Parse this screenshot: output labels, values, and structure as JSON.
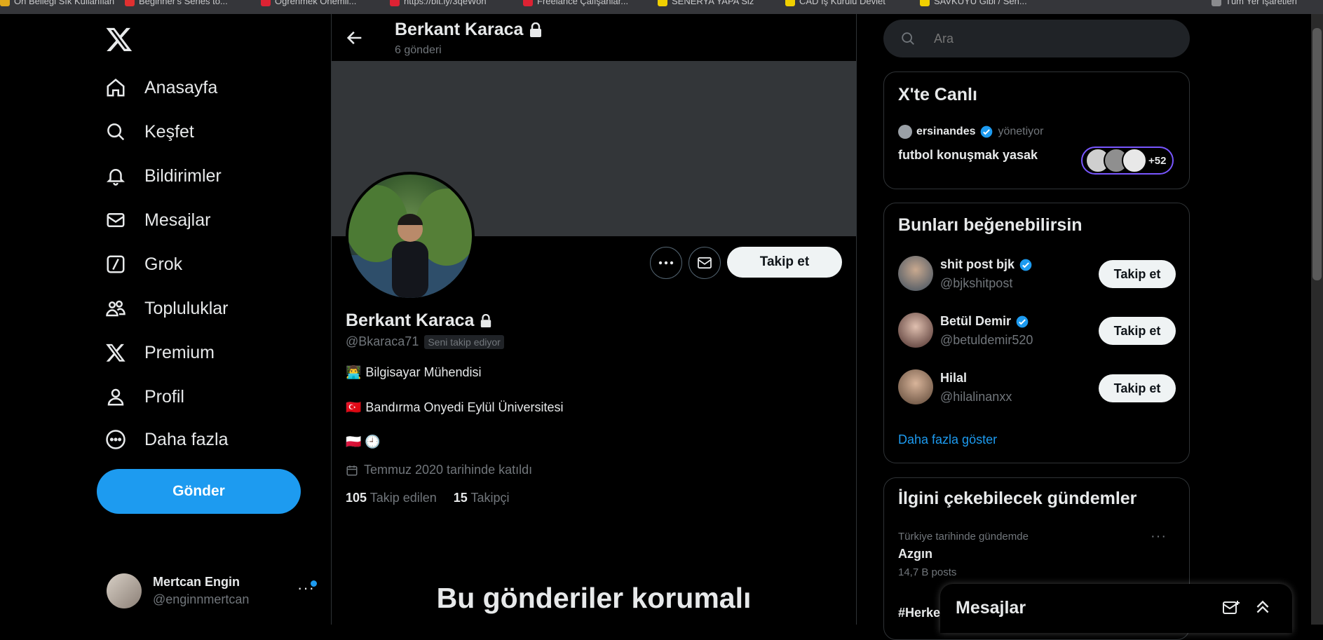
{
  "browser": {
    "bookmarks": [
      "Ön Belleği Sık Kullanılan",
      "Beginner's Series to...",
      "Öğrenmek Önemli...",
      "https://bit.ly/3qeWoh",
      "Freelance Çalışanlar...",
      "SENERYA YAPA Siz",
      "CAD İş Kurulu Devlet",
      "SAVKUYU Gibi / Sen...",
      "Tüm Yer İşaretleri"
    ]
  },
  "nav": {
    "items": [
      {
        "label": "Anasayfa",
        "icon": "home-icon"
      },
      {
        "label": "Keşfet",
        "icon": "search-icon"
      },
      {
        "label": "Bildirimler",
        "icon": "bell-icon"
      },
      {
        "label": "Mesajlar",
        "icon": "mail-icon"
      },
      {
        "label": "Grok",
        "icon": "grok-icon"
      },
      {
        "label": "Topluluklar",
        "icon": "people-icon"
      },
      {
        "label": "Premium",
        "icon": "x-logo-icon"
      },
      {
        "label": "Profil",
        "icon": "person-icon"
      },
      {
        "label": "Daha fazla",
        "icon": "more-circle-icon"
      }
    ],
    "post_button": "Gönder"
  },
  "account": {
    "name": "Mertcan Engin",
    "handle": "@enginnmertcan",
    "more": "···"
  },
  "header": {
    "title": "Berkant Karaca",
    "subtitle": "6 gönderi"
  },
  "profile": {
    "name": "Berkant Karaca",
    "handle": "@Bkaraca71",
    "follows_you": "Seni takip ediyor",
    "follow_button": "Takip et",
    "bio": [
      {
        "emoji": "👨‍💻",
        "text": "Bilgisayar Mühendisi"
      },
      {
        "emoji": "🇹🇷",
        "text": "Bandırma Onyedi Eylül Üniversitesi"
      },
      {
        "emoji": "🇵🇱 🕘",
        "text": ""
      }
    ],
    "joined": "Temmuz 2020 tarihinde katıldı",
    "following_count": "105",
    "following_label": "Takip edilen",
    "followers_count": "15",
    "followers_label": "Takipçi",
    "protected_title": "Bu gönderiler korumalı"
  },
  "search": {
    "placeholder": "Ara"
  },
  "live": {
    "title": "X'te Canlı",
    "host": "ersinandes",
    "host_suffix": "yönetiyor",
    "topic": "futbol konuşmak yasak",
    "listeners": "+52"
  },
  "suggestions": {
    "title": "Bunları beğenebilirsin",
    "items": [
      {
        "name": "shit post bjk",
        "handle": "@bjkshitpost",
        "verified": true,
        "button": "Takip et"
      },
      {
        "name": "Betül Demir",
        "handle": "@betuldemir520",
        "verified": true,
        "button": "Takip et"
      },
      {
        "name": "Hilal",
        "handle": "@hilalinanxx",
        "verified": false,
        "button": "Takip et"
      }
    ],
    "show_more": "Daha fazla göster"
  },
  "trends": {
    "title": "İlgini çekebilecek gündemler",
    "items": [
      {
        "context": "Türkiye tarihinde gündemde",
        "name": "Azgın",
        "count": "14,7 B posts"
      },
      {
        "context": "",
        "name": "#Herke",
        "count": ""
      }
    ]
  },
  "messages_drawer": {
    "title": "Mesajlar"
  },
  "colors": {
    "accent": "#1d9bf0",
    "background": "#000000",
    "border": "#2f3336",
    "muted": "#71767b"
  }
}
